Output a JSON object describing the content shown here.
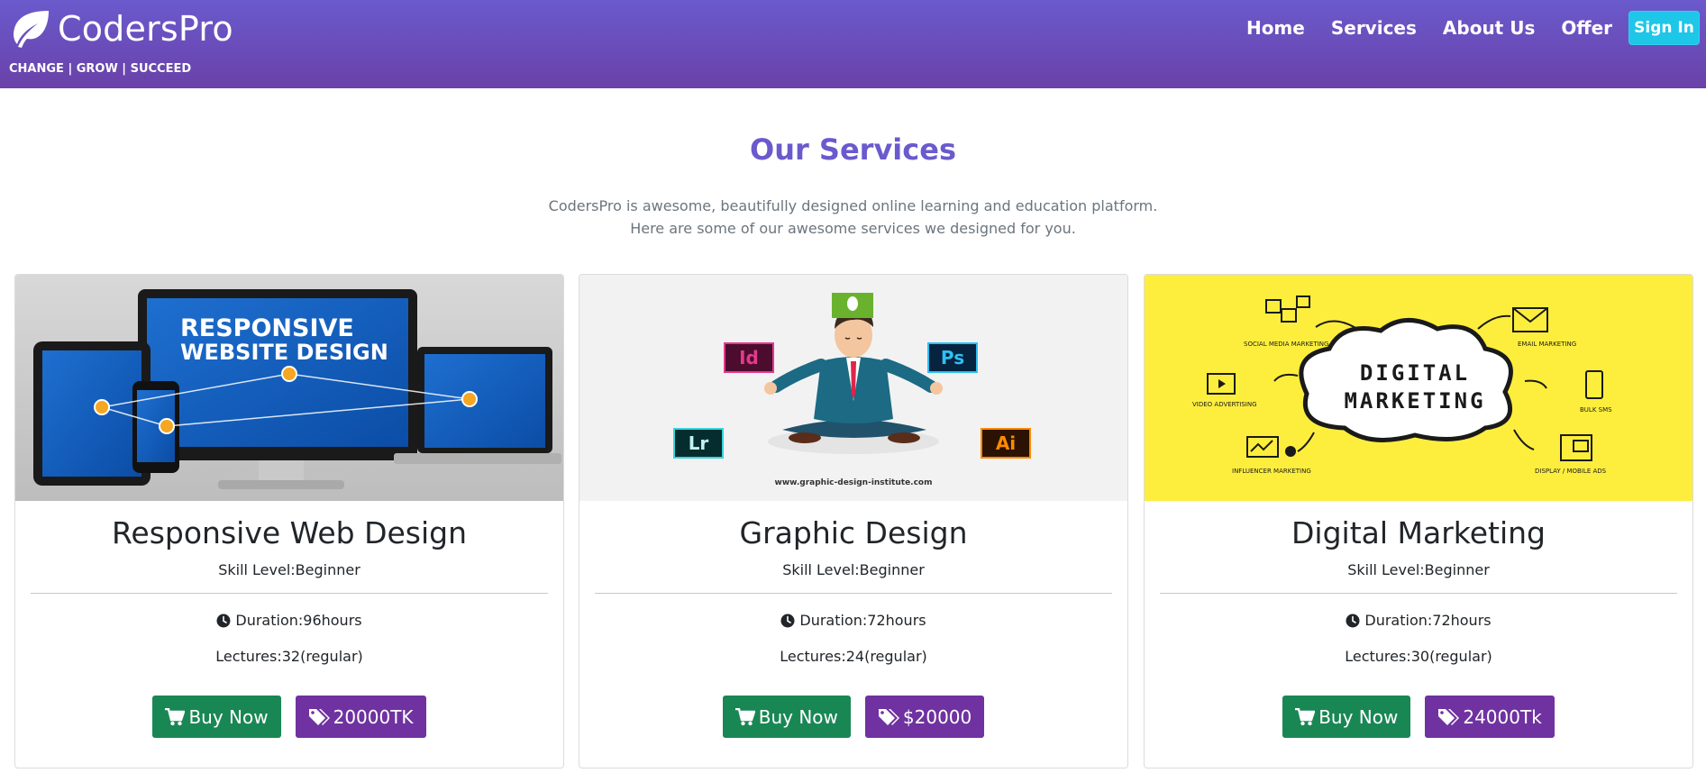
{
  "header": {
    "brand": "CodersPro",
    "tagline": "CHANGE | GROW | SUCCEED",
    "nav": [
      "Home",
      "Services",
      "About Us",
      "Offer"
    ],
    "signin": "Sign In"
  },
  "services": {
    "title": "Our Services",
    "desc_line1": "CodersPro is awesome, beautifully designed online learning and education platform.",
    "desc_line2": "Here are some of our awesome services we designed for you."
  },
  "cards": [
    {
      "image": {
        "headline_line1": "RESPONSIVE",
        "headline_line2": "WEBSITE DESIGN"
      },
      "title": "Responsive Web Design",
      "skill": "Skill Level:Beginner",
      "duration": "Duration:96hours",
      "lectures": "Lectures:32(regular)",
      "buy_label": "Buy Now",
      "price": "20000TK"
    },
    {
      "image": {
        "badge_id": "Id",
        "badge_ps": "Ps",
        "badge_lr": "Lr",
        "badge_ai": "Ai",
        "url": "www.graphic-design-institute.com"
      },
      "title": "Graphic Design",
      "skill": "Skill Level:Beginner",
      "duration": "Duration:72hours",
      "lectures": "Lectures:24(regular)",
      "buy_label": "Buy Now",
      "price": "$20000"
    },
    {
      "image": {
        "cloud_line1": "DIGITAL",
        "cloud_line2": "MARKETING",
        "social": "SOCIAL MEDIA MARKETING",
        "email": "EMAIL MARKETING",
        "video": "VIDEO ADVERTISING",
        "sms": "BULK SMS",
        "influencer": "INFLUENCER MARKETING",
        "display": "DISPLAY / MOBILE ADS"
      },
      "title": "Digital Marketing",
      "skill": "Skill Level:Beginner",
      "duration": "Duration:72hours",
      "lectures": "Lectures:30(regular)",
      "buy_label": "Buy Now",
      "price": "24000Tk"
    }
  ],
  "colors": {
    "header_top": "#6a5acd",
    "header_bottom": "#6a41a8",
    "signin": "#1ec6e8",
    "title": "#6a5acd",
    "buy": "#198754",
    "price": "#6f32a0",
    "marketing_bg": "#fdee3d"
  },
  "icons": {
    "brand": "leaf-icon",
    "duration": "clock-icon",
    "buy": "cart-icon",
    "price": "tags-icon"
  }
}
